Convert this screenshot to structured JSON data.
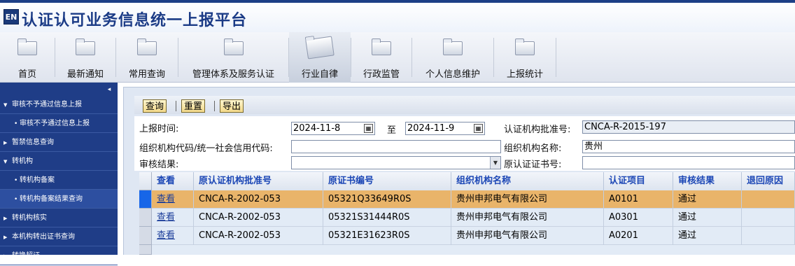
{
  "app": {
    "logo_text": "EN",
    "title": "认证认可业务信息统一上报平台"
  },
  "menu": [
    {
      "label": "首页"
    },
    {
      "label": "最新通知"
    },
    {
      "label": "常用查询"
    },
    {
      "label": "管理体系及服务认证"
    },
    {
      "label": "行业自律",
      "active": true
    },
    {
      "label": "行政监管"
    },
    {
      "label": "个人信息维护"
    },
    {
      "label": "上报统计"
    }
  ],
  "sidebar": {
    "collapse_icon": "◂",
    "items": [
      {
        "label": "审核不予通过信息上报",
        "level": 1
      },
      {
        "label": "审核不予通过信息上报",
        "level": 2
      },
      {
        "label": "暂禁信息查询",
        "level": 1
      },
      {
        "label": "转机构",
        "level": 1
      },
      {
        "label": "转机构备案",
        "level": 2
      },
      {
        "label": "转机构备案结果查询",
        "level": 2,
        "selected": true
      },
      {
        "label": "转机构核实",
        "level": 1
      },
      {
        "label": "本机构转出证书查询",
        "level": 1
      },
      {
        "label": "转换超证",
        "level": 1
      }
    ]
  },
  "toolbar": {
    "query": "查询",
    "reset": "重置",
    "export": "导出"
  },
  "form": {
    "report_time_label": "上报时间:",
    "date_from": "2024-11-8",
    "to_label": "至",
    "date_to": "2024-11-9",
    "cert_body_no_label": "认证机构批准号:",
    "cert_body_no": "CNCA-R-2015-197",
    "org_code_label": "组织机构代码/统一社会信用代码:",
    "org_code": "",
    "org_name_label": "组织机构名称:",
    "org_name": "贵州",
    "review_result_label": "审核结果:",
    "review_result": "",
    "orig_cert_no_label": "原认证证书号:",
    "orig_cert_no": ""
  },
  "table": {
    "headers": [
      "查看",
      "原认证机构批准号",
      "原证书编号",
      "组织机构名称",
      "认证项目",
      "审核结果",
      "退回原因"
    ],
    "rows": [
      {
        "view": "查看",
        "orig_body_no": "CNCA-R-2002-053",
        "orig_cert_no": "05321Q33649R0S",
        "org_name": "贵州申邦电气有限公司",
        "project": "A0101",
        "result": "通过",
        "reason": ""
      },
      {
        "view": "查看",
        "orig_body_no": "CNCA-R-2002-053",
        "orig_cert_no": "05321S31444R0S",
        "org_name": "贵州申邦电气有限公司",
        "project": "A0301",
        "result": "通过",
        "reason": ""
      },
      {
        "view": "查看",
        "orig_body_no": "CNCA-R-2002-053",
        "orig_cert_no": "05321E31623R0S",
        "org_name": "贵州申邦电气有限公司",
        "project": "A0201",
        "result": "通过",
        "reason": ""
      }
    ]
  }
}
